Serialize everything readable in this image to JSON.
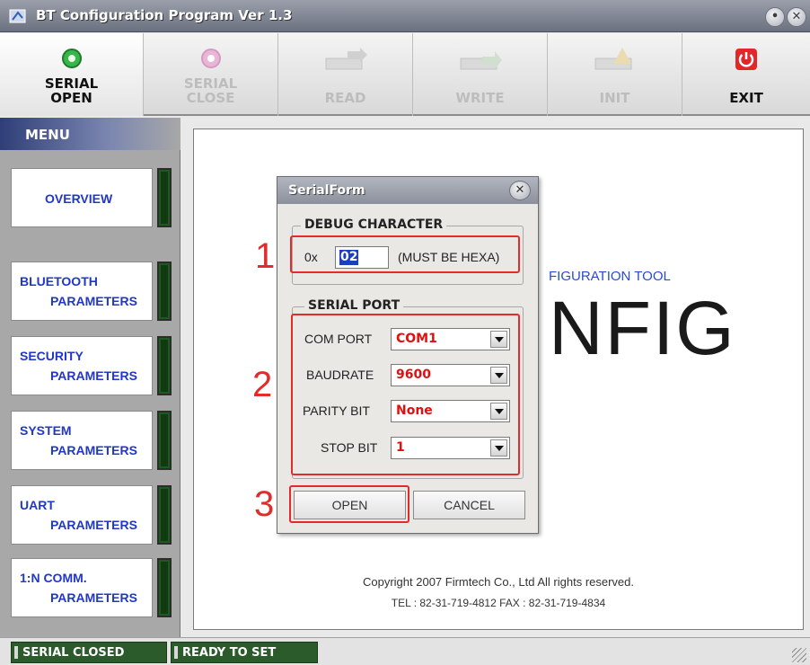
{
  "window": {
    "title": "BT Configuration Program Ver 1.3",
    "minimize_glyph": "•",
    "close_glyph": "✕"
  },
  "toolbar": {
    "serial_open": "SERIAL\nOPEN",
    "serial_close": "SERIAL\nCLOSE",
    "read": "READ",
    "write": "WRITE",
    "init": "INIT",
    "exit": "EXIT"
  },
  "menu": {
    "title": "MENU",
    "items": [
      {
        "line1": "OVERVIEW",
        "line2": ""
      },
      {
        "line1": "BLUETOOTH",
        "line2": "PARAMETERS"
      },
      {
        "line1": "SECURITY",
        "line2": "PARAMETERS"
      },
      {
        "line1": "SYSTEM",
        "line2": "PARAMETERS"
      },
      {
        "line1": "UART",
        "line2": "PARAMETERS"
      },
      {
        "line1": "1:N COMM.",
        "line2": "PARAMETERS"
      }
    ]
  },
  "content": {
    "title_fragment": "FIGURATION TOOL",
    "logo_fragment": "NFIG",
    "copyright": "Copyright 2007 Firmtech Co., Ltd All rights reserved.",
    "contact": "TEL : 82-31-719-4812     FAX : 82-31-719-4834"
  },
  "dialog": {
    "title": "SerialForm",
    "close_glyph": "✕",
    "debug_group": "DEBUG CHARACTER",
    "prefix": "0x",
    "debug_value": "02",
    "debug_hint": "(MUST BE HEXA)",
    "serial_group": "SERIAL PORT",
    "fields": [
      {
        "label": "COM PORT",
        "value": "COM1"
      },
      {
        "label": "BAUDRATE",
        "value": "9600"
      },
      {
        "label": "PARITY BIT",
        "value": "None"
      },
      {
        "label": "STOP BIT",
        "value": "1"
      }
    ],
    "open_button": "OPEN",
    "cancel_button": "CANCEL"
  },
  "annotations": [
    "1",
    "2",
    "3"
  ],
  "status": {
    "serial": "SERIAL CLOSED",
    "ready": "READY TO SET"
  },
  "colors": {
    "annotation_red": "#e32b2b",
    "menu_text_blue": "#2037c8",
    "combo_value_red": "#e01010",
    "status_green": "#2b5a2b"
  }
}
